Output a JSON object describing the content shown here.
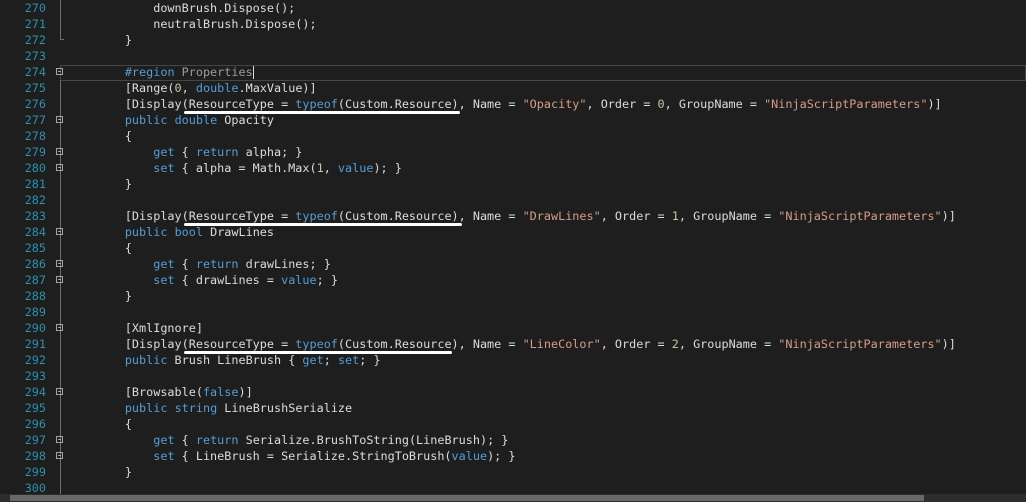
{
  "editor": {
    "lines": [
      {
        "n": "270",
        "fold": false,
        "guide": "mid",
        "tokens": [
          [
            "default",
            "            downBrush.Dispose();"
          ]
        ]
      },
      {
        "n": "271",
        "fold": false,
        "guide": "mid",
        "tokens": [
          [
            "default",
            "            neutralBrush.Dispose();"
          ]
        ]
      },
      {
        "n": "272",
        "fold": false,
        "guide": "end",
        "tokens": [
          [
            "default",
            "        }"
          ]
        ]
      },
      {
        "n": "273",
        "fold": false,
        "guide": "none",
        "tokens": []
      },
      {
        "n": "274",
        "fold": true,
        "guide": "none",
        "tokens": [
          [
            "default",
            "        "
          ],
          [
            "keyword",
            "#region"
          ],
          [
            "region",
            " Properties"
          ]
        ]
      },
      {
        "n": "275",
        "fold": false,
        "guide": "mid",
        "tokens": [
          [
            "default",
            "        [Range("
          ],
          [
            "number",
            "0"
          ],
          [
            "default",
            ", "
          ],
          [
            "keyword",
            "double"
          ],
          [
            "default",
            ".MaxValue)]"
          ]
        ]
      },
      {
        "n": "276",
        "fold": false,
        "guide": "mid",
        "tokens": [
          [
            "default",
            "        [Display(ResourceType = "
          ],
          [
            "keyword",
            "typeof"
          ],
          [
            "default",
            "(Custom.Resource), Name = "
          ],
          [
            "string",
            "\"Opacity\""
          ],
          [
            "default",
            ", Order = "
          ],
          [
            "number",
            "0"
          ],
          [
            "default",
            ", GroupName = "
          ],
          [
            "string",
            "\"NinjaScriptParameters\""
          ],
          [
            "default",
            ")]"
          ]
        ]
      },
      {
        "n": "277",
        "fold": true,
        "guide": "mid",
        "tokens": [
          [
            "default",
            "        "
          ],
          [
            "keyword",
            "public"
          ],
          [
            "default",
            " "
          ],
          [
            "keyword",
            "double"
          ],
          [
            "default",
            " Opacity"
          ]
        ]
      },
      {
        "n": "278",
        "fold": false,
        "guide": "mid",
        "tokens": [
          [
            "default",
            "        {"
          ]
        ]
      },
      {
        "n": "279",
        "fold": true,
        "guide": "mid",
        "tokens": [
          [
            "default",
            "            "
          ],
          [
            "keyword",
            "get"
          ],
          [
            "default",
            " { "
          ],
          [
            "keyword",
            "return"
          ],
          [
            "default",
            " alpha; }"
          ]
        ]
      },
      {
        "n": "280",
        "fold": true,
        "guide": "mid",
        "tokens": [
          [
            "default",
            "            "
          ],
          [
            "keyword",
            "set"
          ],
          [
            "default",
            " { alpha = Math.Max("
          ],
          [
            "number",
            "1"
          ],
          [
            "default",
            ", "
          ],
          [
            "keyword",
            "value"
          ],
          [
            "default",
            "); }"
          ]
        ]
      },
      {
        "n": "281",
        "fold": false,
        "guide": "mid",
        "tokens": [
          [
            "default",
            "        }"
          ]
        ]
      },
      {
        "n": "282",
        "fold": false,
        "guide": "mid",
        "tokens": []
      },
      {
        "n": "283",
        "fold": false,
        "guide": "mid",
        "tokens": [
          [
            "default",
            "        [Display(ResourceType = "
          ],
          [
            "keyword",
            "typeof"
          ],
          [
            "default",
            "(Custom.Resource), Name = "
          ],
          [
            "string",
            "\"DrawLines\""
          ],
          [
            "default",
            ", Order = "
          ],
          [
            "number",
            "1"
          ],
          [
            "default",
            ", GroupName = "
          ],
          [
            "string",
            "\"NinjaScriptParameters\""
          ],
          [
            "default",
            ")]"
          ]
        ]
      },
      {
        "n": "284",
        "fold": true,
        "guide": "mid",
        "tokens": [
          [
            "default",
            "        "
          ],
          [
            "keyword",
            "public"
          ],
          [
            "default",
            " "
          ],
          [
            "keyword",
            "bool"
          ],
          [
            "default",
            " DrawLines"
          ]
        ]
      },
      {
        "n": "285",
        "fold": false,
        "guide": "mid",
        "tokens": [
          [
            "default",
            "        {"
          ]
        ]
      },
      {
        "n": "286",
        "fold": true,
        "guide": "mid",
        "tokens": [
          [
            "default",
            "            "
          ],
          [
            "keyword",
            "get"
          ],
          [
            "default",
            " { "
          ],
          [
            "keyword",
            "return"
          ],
          [
            "default",
            " drawLines; }"
          ]
        ]
      },
      {
        "n": "287",
        "fold": true,
        "guide": "mid",
        "tokens": [
          [
            "default",
            "            "
          ],
          [
            "keyword",
            "set"
          ],
          [
            "default",
            " { drawLines = "
          ],
          [
            "keyword",
            "value"
          ],
          [
            "default",
            "; }"
          ]
        ]
      },
      {
        "n": "288",
        "fold": false,
        "guide": "mid",
        "tokens": [
          [
            "default",
            "        }"
          ]
        ]
      },
      {
        "n": "289",
        "fold": false,
        "guide": "mid",
        "tokens": []
      },
      {
        "n": "290",
        "fold": true,
        "guide": "mid",
        "tokens": [
          [
            "default",
            "        [XmlIgnore]"
          ]
        ]
      },
      {
        "n": "291",
        "fold": false,
        "guide": "mid",
        "tokens": [
          [
            "default",
            "        [Display(ResourceType = "
          ],
          [
            "keyword",
            "typeof"
          ],
          [
            "default",
            "(Custom.Resource), Name = "
          ],
          [
            "string",
            "\"LineColor\""
          ],
          [
            "default",
            ", Order = "
          ],
          [
            "number",
            "2"
          ],
          [
            "default",
            ", GroupName = "
          ],
          [
            "string",
            "\"NinjaScriptParameters\""
          ],
          [
            "default",
            ")]"
          ]
        ]
      },
      {
        "n": "292",
        "fold": false,
        "guide": "mid",
        "tokens": [
          [
            "default",
            "        "
          ],
          [
            "keyword",
            "public"
          ],
          [
            "default",
            " Brush LineBrush { "
          ],
          [
            "keyword",
            "get"
          ],
          [
            "default",
            "; "
          ],
          [
            "keyword",
            "set"
          ],
          [
            "default",
            "; }"
          ]
        ]
      },
      {
        "n": "293",
        "fold": false,
        "guide": "mid",
        "tokens": []
      },
      {
        "n": "294",
        "fold": true,
        "guide": "mid",
        "tokens": [
          [
            "default",
            "        [Browsable("
          ],
          [
            "keyword",
            "false"
          ],
          [
            "default",
            ")]"
          ]
        ]
      },
      {
        "n": "295",
        "fold": false,
        "guide": "mid",
        "tokens": [
          [
            "default",
            "        "
          ],
          [
            "keyword",
            "public"
          ],
          [
            "default",
            " "
          ],
          [
            "keyword",
            "string"
          ],
          [
            "default",
            " LineBrushSerialize"
          ]
        ]
      },
      {
        "n": "296",
        "fold": false,
        "guide": "mid",
        "tokens": [
          [
            "default",
            "        {"
          ]
        ]
      },
      {
        "n": "297",
        "fold": true,
        "guide": "mid",
        "tokens": [
          [
            "default",
            "            "
          ],
          [
            "keyword",
            "get"
          ],
          [
            "default",
            " { "
          ],
          [
            "keyword",
            "return"
          ],
          [
            "default",
            " Serialize.BrushToString(LineBrush); }"
          ]
        ]
      },
      {
        "n": "298",
        "fold": true,
        "guide": "mid",
        "tokens": [
          [
            "default",
            "            "
          ],
          [
            "keyword",
            "set"
          ],
          [
            "default",
            " { LineBrush = Serialize.StringToBrush("
          ],
          [
            "keyword",
            "value"
          ],
          [
            "default",
            "); }"
          ]
        ]
      },
      {
        "n": "299",
        "fold": false,
        "guide": "mid",
        "tokens": [
          [
            "default",
            "        }"
          ]
        ]
      },
      {
        "n": "300",
        "fold": false,
        "guide": "mid",
        "tokens": []
      }
    ]
  },
  "colors": {
    "background": "#1e1e1e",
    "line_number": "#2b91af",
    "keyword": "#569cd6",
    "string": "#d69d85",
    "number": "#b5cea8",
    "default_text": "#dcdcdc",
    "annotation_underline": "#ffffff"
  }
}
